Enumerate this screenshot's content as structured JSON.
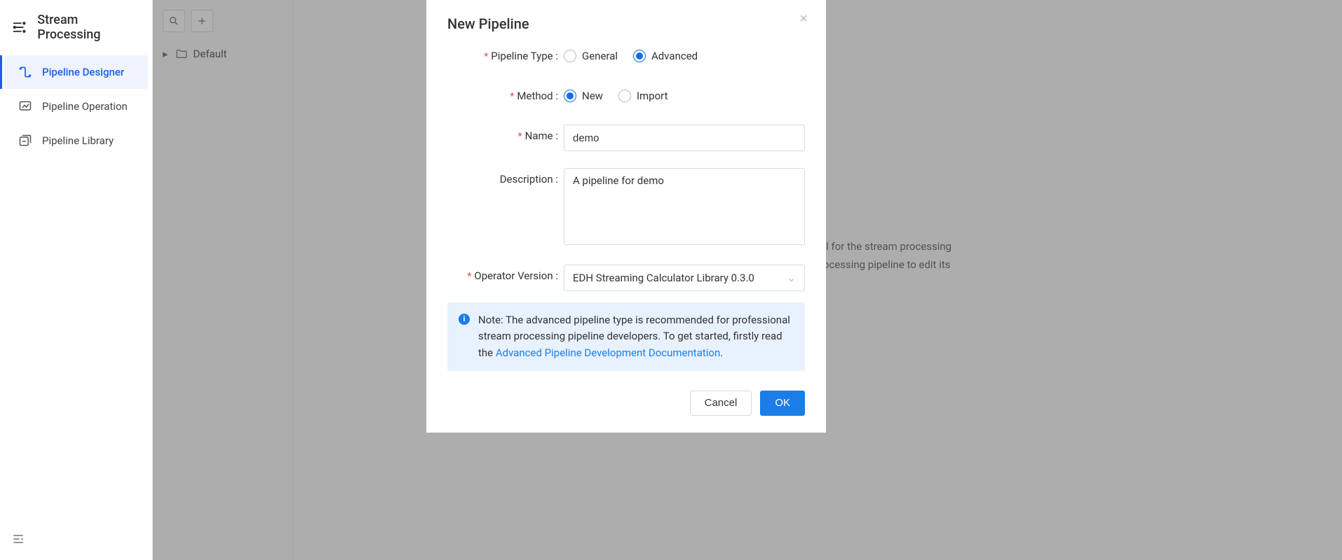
{
  "sidebar": {
    "title": "Stream Processing",
    "items": [
      {
        "label": "Pipeline Designer"
      },
      {
        "label": "Pipeline Operation"
      },
      {
        "label": "Pipeline Library"
      }
    ]
  },
  "tree": {
    "root_label": "Default"
  },
  "background_hint": {
    "line1": "You can create a directory level for the stream processing",
    "line2": "pipeline, and click a stream processing pipeline to edit its"
  },
  "modal": {
    "title": "New Pipeline",
    "close_glyph": "×",
    "labels": {
      "pipeline_type": "Pipeline Type",
      "method": "Method",
      "name": "Name",
      "description": "Description",
      "operator_version": "Operator Version"
    },
    "pipeline_type": {
      "options": [
        {
          "label": "General",
          "checked": false
        },
        {
          "label": "Advanced",
          "checked": true
        }
      ]
    },
    "method": {
      "options": [
        {
          "label": "New",
          "checked": true
        },
        {
          "label": "Import",
          "checked": false
        }
      ]
    },
    "name_value": "demo",
    "description_value": "A pipeline for demo",
    "operator_version_value": "EDH Streaming Calculator Library 0.3.0",
    "note": {
      "prefix": "Note: The advanced pipeline type is recommended for professional stream processing pipeline developers. To get started, firstly read the ",
      "link": "Advanced Pipeline Development Documentation",
      "suffix": "."
    },
    "buttons": {
      "cancel": "Cancel",
      "ok": "OK"
    }
  }
}
